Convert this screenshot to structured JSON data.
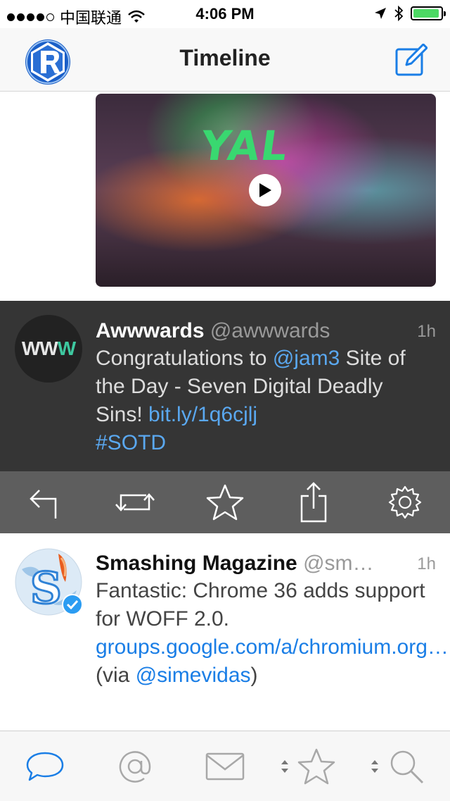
{
  "status_bar": {
    "carrier": "中国联通",
    "time": "4:06 PM",
    "battery_level": 0.95,
    "signal_bars_filled": 4,
    "signal_bars_total": 5
  },
  "nav": {
    "title": "Timeline",
    "logo_icon": "app-logo-icon",
    "compose_icon": "compose-icon"
  },
  "media": {
    "overlay_text": "YAL",
    "play_icon": "play-icon"
  },
  "tweets": [
    {
      "name": "Awwwards",
      "handle": "@awwwards",
      "time": "1h",
      "avatar_text_a": "WW",
      "avatar_text_b": "W",
      "body_1": "Congratulations to ",
      "mention": "@jam3",
      "body_2": " Site of the Day - Seven Digital Deadly Sins! ",
      "link": "bit.ly/1q6cjlj",
      "hashtag": "#SOTD"
    },
    {
      "name": "Smashing Magazine",
      "handle": "@sm…",
      "time": "1h",
      "body_1": "Fantastic: Chrome 36 adds support for WOFF 2.0. ",
      "link": "groups.google.com/a/chromium.org…",
      "body_2": " (via ",
      "mention": "@simevidas",
      "body_3": ")"
    }
  ],
  "actions": [
    "reply-icon",
    "retweet-icon",
    "favorite-icon",
    "share-icon",
    "settings-icon"
  ],
  "tabs": [
    "timeline-tab-icon",
    "mentions-tab-icon",
    "messages-tab-icon",
    "favorites-tab-icon",
    "search-tab-icon"
  ],
  "colors": {
    "accent": "#1a7ee6",
    "dark_tweet_bg": "#353535",
    "action_bar_bg": "#5e5e5e",
    "battery": "#4cd964"
  }
}
